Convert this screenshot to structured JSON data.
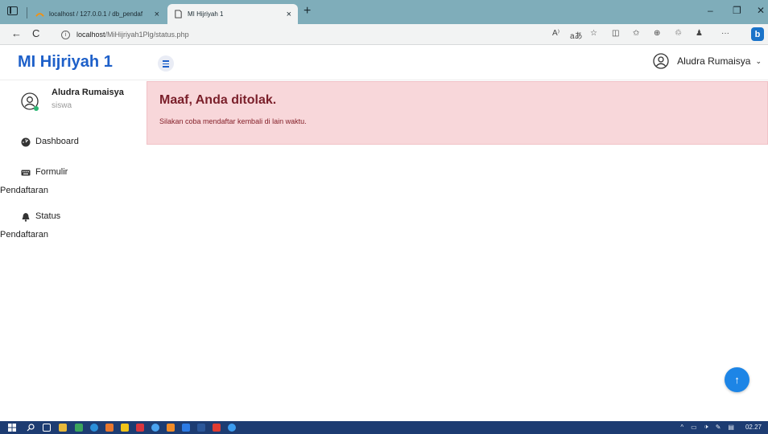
{
  "browser": {
    "tabs": [
      {
        "title": "localhost / 127.0.0.1 / db_pendaf",
        "close": "×"
      },
      {
        "title": "MI Hijriyah 1",
        "close": "×"
      }
    ],
    "new_tab": "+",
    "window_controls": {
      "minimize": "–",
      "restore": "❐",
      "close": "✕"
    },
    "nav": {
      "back": "←",
      "reload": "C"
    },
    "url_host": "localhost",
    "url_path": "/MiHijriyah1Plg/status.php",
    "toolbar_icons": [
      "A⁾",
      "aあ",
      "☆",
      "◫",
      "✩",
      "⊕",
      "♲",
      "♟",
      "···"
    ],
    "bing_label": "b",
    "bing_color": "#1a73c9"
  },
  "header": {
    "brand": "MI Hijriyah 1",
    "brand_color": "#1e60c9",
    "user_name": "Aludra Rumaisya",
    "chevron": "⌄"
  },
  "sidebar": {
    "profile": {
      "name": "Aludra Rumaisya",
      "role": "siswa"
    },
    "items": [
      {
        "icon": "dashboard-icon",
        "line1": "Dashboard",
        "line2": ""
      },
      {
        "icon": "keyboard-icon",
        "line1": "Formulir",
        "line2": "Pendaftaran"
      },
      {
        "icon": "bell-icon",
        "line1": "Status",
        "line2": "Pendaftaran"
      }
    ]
  },
  "main": {
    "alert": {
      "title": "Maaf, Anda ditolak.",
      "message": "Silakan coba mendaftar kembali di lain waktu.",
      "bg_color": "#f8d7da",
      "text_color": "#842029"
    },
    "back_to_top": "↑",
    "back_to_top_color": "#1d85e6"
  },
  "taskbar": {
    "clock": "02.27",
    "tray_icons": [
      "^",
      "▭",
      "🕩",
      "✎",
      "▤"
    ],
    "bg_color": "#1d3c72"
  }
}
